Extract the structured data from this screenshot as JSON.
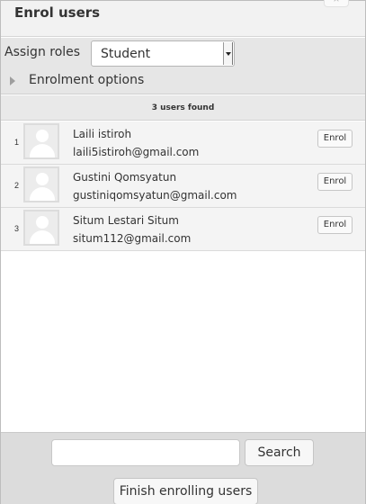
{
  "dialog": {
    "title": "Enrol users",
    "close_glyph": "×"
  },
  "options": {
    "assign_roles_label": "Assign roles",
    "role_selected": "Student",
    "enrolment_options_label": "Enrolment options"
  },
  "results": {
    "summary": "3 users found",
    "users": [
      {
        "index": "1",
        "name": "Laili istiroh",
        "email": "laili5istiroh@gmail.com",
        "action": "Enrol"
      },
      {
        "index": "2",
        "name": "Gustini Qomsyatun",
        "email": "gustiniqomsyatun@gmail.com",
        "action": "Enrol"
      },
      {
        "index": "3",
        "name": "Situm Lestari Situm",
        "email": "situm112@gmail.com",
        "action": "Enrol"
      }
    ]
  },
  "footer": {
    "search_value": "",
    "search_button": "Search",
    "finish_button": "Finish enrolling users"
  },
  "icons": {
    "close": "close-icon",
    "dropdown": "chevron-down-icon",
    "expand": "triangle-right-icon",
    "avatar": "user-avatar-icon"
  }
}
